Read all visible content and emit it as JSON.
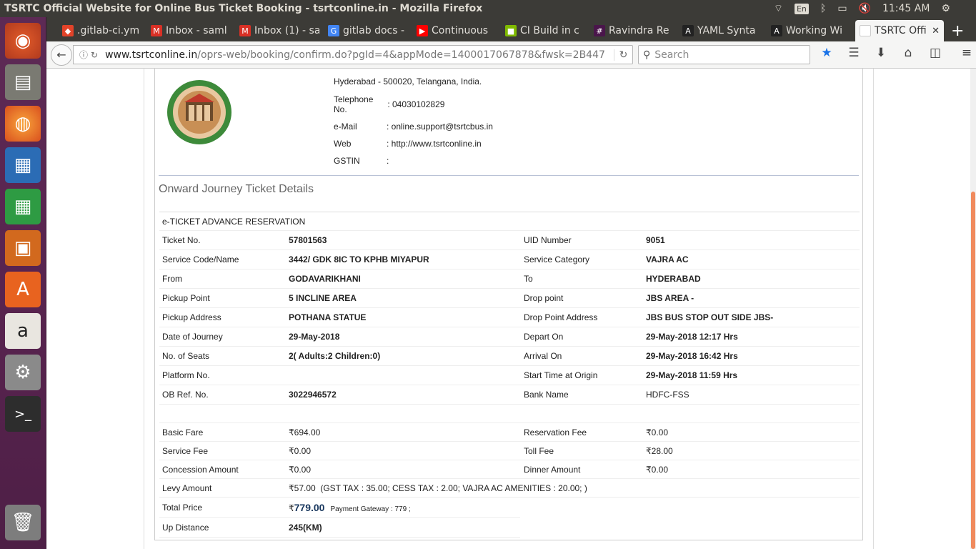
{
  "os_bar": {
    "window_title": "TSRTC Official Website for Online Bus Ticket Booking - tsrtconline.in - Mozilla Firefox",
    "keyboard": "En",
    "time": "11:45 AM"
  },
  "tabs": [
    {
      "label": ".gitlab-ci.ym",
      "icon": "gitlab-icon",
      "color": "#e24329"
    },
    {
      "label": "Inbox - saml",
      "icon": "gmail-icon",
      "color": "#d93025"
    },
    {
      "label": "Inbox (1) - sa",
      "icon": "gmail-icon",
      "color": "#d93025"
    },
    {
      "label": "gitlab docs -",
      "icon": "google-icon",
      "color": "#4285f4"
    },
    {
      "label": "Continuous",
      "icon": "youtube-icon",
      "color": "#ff0000"
    },
    {
      "label": "CI Build in c",
      "icon": "microsoft-icon",
      "color": "#7fba00"
    },
    {
      "label": "Ravindra Re",
      "icon": "slack-icon",
      "color": "#4a154b"
    },
    {
      "label": "YAML Synta",
      "icon": "atom-icon",
      "color": "#222222"
    },
    {
      "label": "Working Wi",
      "icon": "atom-icon",
      "color": "#222222"
    },
    {
      "label": "TSRTC Offi",
      "icon": "page-icon",
      "color": "#ffffff",
      "active": true
    }
  ],
  "navbar": {
    "url_host": "www.tsrtconline.in",
    "url_path": "/oprs-web/booking/confirm.do?pgId=4&appMode=1400017067878&fwsk=2B447",
    "search_placeholder": "Search"
  },
  "contact": {
    "address": "Hyderabad - 500020, Telangana, India.",
    "telephone_label": "Telephone No.",
    "telephone_value": ": 04030102829",
    "email_label": "e-Mail",
    "email_value": ": online.support@tsrtcbus.in",
    "web_label": "Web",
    "web_value": ": http://www.tsrtconline.in",
    "gstin_label": "GSTIN",
    "gstin_value": ":"
  },
  "section_title": "Onward Journey Ticket Details",
  "reservation_type": "e-TICKET ADVANCE RESERVATION",
  "details": [
    {
      "l1": "Ticket No.",
      "v1": "57801563",
      "l2": "UID Number",
      "v2": "9051"
    },
    {
      "l1": "Service Code/Name",
      "v1": "3442/ GDK 8IC TO KPHB MIYAPUR",
      "l2": "Service Category",
      "v2": "VAJRA AC"
    },
    {
      "l1": "From",
      "v1": "GODAVARIKHANI",
      "l2": "To",
      "v2": "HYDERABAD"
    },
    {
      "l1": "Pickup Point",
      "v1": "5 INCLINE AREA",
      "l2": "Drop point",
      "v2": "JBS AREA -"
    },
    {
      "l1": "Pickup Address",
      "v1": "POTHANA STATUE",
      "l2": "Drop Point Address",
      "v2": "JBS BUS STOP OUT SIDE JBS-"
    },
    {
      "l1": "Date of Journey",
      "v1": "29-May-2018",
      "l2": "Depart On",
      "v2": "29-May-2018 12:17 Hrs"
    },
    {
      "l1": "No. of Seats",
      "v1": "2( Adults:2  Children:0)",
      "l2": "Arrival On",
      "v2": "29-May-2018 16:42 Hrs"
    },
    {
      "l1": "Platform No.",
      "v1": "",
      "l2": "Start Time at Origin",
      "v2": "29-May-2018 11:59 Hrs"
    },
    {
      "l1": "OB Ref. No.",
      "v1": "3022946572",
      "l2": "Bank Name",
      "v2": "HDFC-FSS"
    }
  ],
  "fares": [
    {
      "l1": "Basic Fare",
      "v1": "694.00",
      "l2": "Reservation Fee",
      "v2": "0.00"
    },
    {
      "l1": "Service Fee",
      "v1": "0.00",
      "l2": "Toll Fee",
      "v2": "28.00"
    },
    {
      "l1": "Concession Amount",
      "v1": "0.00",
      "l2": "Dinner Amount",
      "v2": "0.00"
    }
  ],
  "currency_symbol": "₹",
  "levy": {
    "label": "Levy Amount",
    "value": "57.00",
    "breakdown": "(GST TAX : 35.00;  CESS TAX : 2.00;  VAJRA AC AMENITIES : 20.00;  )"
  },
  "total": {
    "label": "Total Price",
    "value": "779.00",
    "note": "Payment Gateway : 779 ;"
  },
  "up_distance": {
    "label": "Up Distance",
    "value": "245(KM)"
  }
}
